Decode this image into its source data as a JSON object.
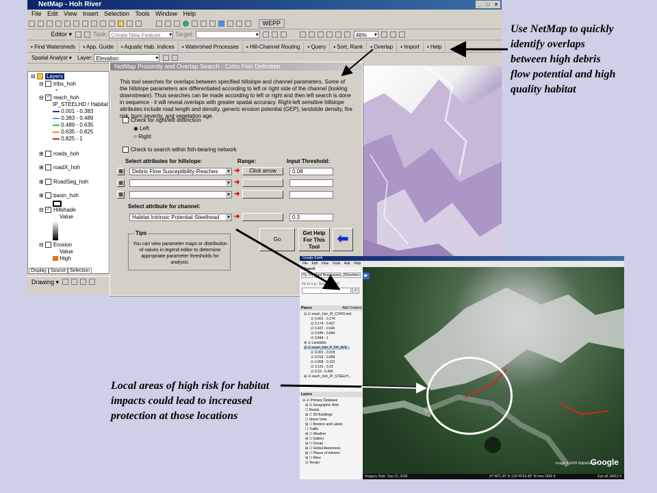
{
  "window": {
    "title": "NetMap - Hoh River",
    "menus": [
      "File",
      "Edit",
      "View",
      "Insert",
      "Selection",
      "Tools",
      "Window",
      "Help"
    ]
  },
  "editor_toolbar": {
    "editor_label": "Editor ▾",
    "task_label": "Task:",
    "task_value": "Create New Feature",
    "target_label": "Target:",
    "zoom_value": "46%"
  },
  "standard_toolbar": {
    "wepp_label": "WEPP"
  },
  "netmap_toolbar": {
    "buttons": [
      "Find Watersheds",
      "App. Guide",
      "Aquatic Hab. Indices",
      "Watershed Processes",
      "Hill-Channel Routing",
      "Query",
      "Sort, Rank",
      "Overlap",
      "Import",
      "Help"
    ]
  },
  "spatial_toolbar": {
    "spatial_analyst": "Spatial Analyst ▾",
    "layer_label": "Layer:",
    "layer_value": "Elevation"
  },
  "toc": {
    "root": "Layers",
    "items": [
      {
        "label": "tribs_hoh",
        "checked": false
      },
      {
        "label": "reach_hoh",
        "checked": true
      },
      {
        "label": "IP_STEELHD / Habitat"
      },
      {
        "label": "0.001 - 0.383",
        "color": "#1f2bb8"
      },
      {
        "label": "0.383 - 0.489",
        "color": "#2fb2d8"
      },
      {
        "label": "0.489 - 0.635",
        "color": "#2fbf3a"
      },
      {
        "label": "0.635 - 0.825",
        "color": "#f08c1c"
      },
      {
        "label": "0.825 - 1",
        "color": "#e01a1a"
      },
      {
        "label": "roads_hoh",
        "checked": false
      },
      {
        "label": "roadX_hoh",
        "checked": false
      },
      {
        "label": "RoadSeg_hoh",
        "checked": false
      },
      {
        "label": "basin_hoh",
        "checked": false
      },
      {
        "label": "Hillshade",
        "checked": true
      },
      {
        "label": "Value"
      },
      {
        "label": "Erosion",
        "checked": false
      },
      {
        "label": "Value"
      },
      {
        "label": "High"
      }
    ],
    "tabs": [
      "Display",
      "Source",
      "Selection"
    ],
    "drawing_label": "Drawing ▾"
  },
  "dialog": {
    "title": "NetMap Proximity and Overlap Search - Coho Fish Definition",
    "description": "This tool searches for overlaps between specified hillslope and channel parameters. Some of the hillslope parameters are differentiated according to left or right side of the channel (looking downstream). Thus searches can be made according to left or right and then left search is done in sequence - it will reveal overlaps with greater spatial accuracy. Right-left sensitive hillslope attributes include road length and density, generic erosion potential (GEP), landslide density, fire risk, burn severity, and vegetation age.",
    "check_left_right": "Check for right/left distinction",
    "radio_left": "Left",
    "radio_right": "Right",
    "check_fish": "Check to search within fish-bearing network",
    "hillslope_header": "Select attributes for hillslope:",
    "range_header": "Range:",
    "threshold_header": "Input Threshold:",
    "hillslope_rows": [
      {
        "value": "Debris Flow Susceptibility-Reaches",
        "range": "Click arrow",
        "threshold": "0.08"
      },
      {
        "value": "",
        "range": "",
        "threshold": ""
      },
      {
        "value": "",
        "range": "",
        "threshold": ""
      }
    ],
    "channel_header": "Select attribute for channel:",
    "channel_value": "Habitat Intrinsic Potential-Steelhead",
    "channel_threshold": "0.3",
    "tips_label": "Tips",
    "tips_text": "You can view parameter maps or distribution of values in legend editor to determine appropriate parameter thresholds for analysis.",
    "go_label": "Go",
    "help_label": "Get Help For This Tool"
  },
  "google_earth": {
    "title": "Google Earth",
    "menus": [
      "File",
      "Edit",
      "View",
      "Tools",
      "Add",
      "Help"
    ],
    "search_label": "Search",
    "search_tabs": [
      "Fly To",
      "Find Businesses",
      "Directions"
    ],
    "fly_to_hint": "Fly to e.g., New York, NY",
    "places_label": "Places",
    "add_content": "Add Content",
    "places": [
      "reach_hoh_IP_COHO.kml",
      "0.001 - 0.174",
      "0.174 - 0.437",
      "0.437 - 0.649",
      "0.649 - 0.844",
      "0.844 - 1",
      "Landslide",
      "reach_hoh_P_DF_AVE...",
      "0.001 - 0.019",
      "0.019 - 0.058",
      "0.058 - 0.123",
      "0.123 - 0.23",
      "0.23 - 0.499",
      "reach_hoh_IP_STEELH..."
    ],
    "layers_label": "Layers",
    "layers": [
      "Primary Database",
      "Geographic Web",
      "Roads",
      "3D Buildings",
      "Street View",
      "Borders and Labels",
      "Traffic",
      "Weather",
      "Gallery",
      "Ocean",
      "Global Awareness",
      "Places of Interest",
      "More",
      "Terrain"
    ],
    "status_left": "Imagery Date: Sep 12, 2006",
    "status_right": "47°48'1.35\" N 123°45'54.48\" W elev 2665 ft",
    "copyright": "Image © 2009 DigitalGlobe",
    "logo": "Google",
    "eye_alt": "Eye alt 18912 ft"
  },
  "callouts": {
    "top": "Use NetMap to quickly identify overlaps between high debris flow potential and high quality habitat",
    "bottom": "Local areas of high risk for habitat impacts could lead to increased protection at those locations"
  }
}
